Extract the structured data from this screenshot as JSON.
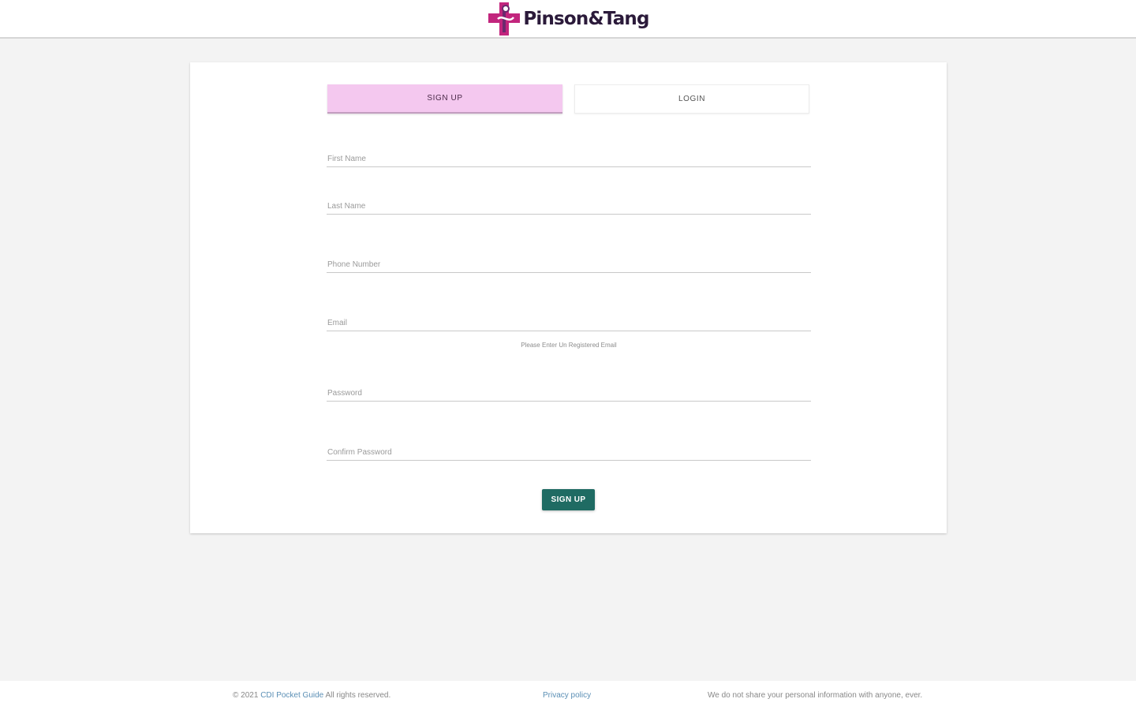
{
  "header": {
    "brand_name": "Pinson&Tang",
    "logo_icon": "medical-cross-logo-icon",
    "colors": {
      "logo_magenta": "#c2257d",
      "logo_purple": "#6b2a6e"
    }
  },
  "tabs": {
    "signup_label": "SIGN UP",
    "login_label": "LOGIN",
    "active": "signup",
    "active_color": "#f4c8ef"
  },
  "form": {
    "first_name": {
      "placeholder": "First Name",
      "value": ""
    },
    "last_name": {
      "placeholder": "Last Name",
      "value": ""
    },
    "phone": {
      "placeholder": "Phone Number",
      "value": ""
    },
    "email": {
      "placeholder": "Email",
      "value": "",
      "hint": "Please Enter Un Registered Email"
    },
    "password": {
      "placeholder": "Password",
      "value": ""
    },
    "confirm_password": {
      "placeholder": "Confirm Password",
      "value": ""
    },
    "submit_label": "SIGN UP",
    "submit_color": "#1f6b63"
  },
  "footer": {
    "copyright_prefix": "© 2021",
    "copyright_link": "CDI Pocket Guide",
    "copyright_suffix": "All rights reserved.",
    "privacy_label": "Privacy policy",
    "note": "We do not share your personal information with anyone, ever."
  }
}
